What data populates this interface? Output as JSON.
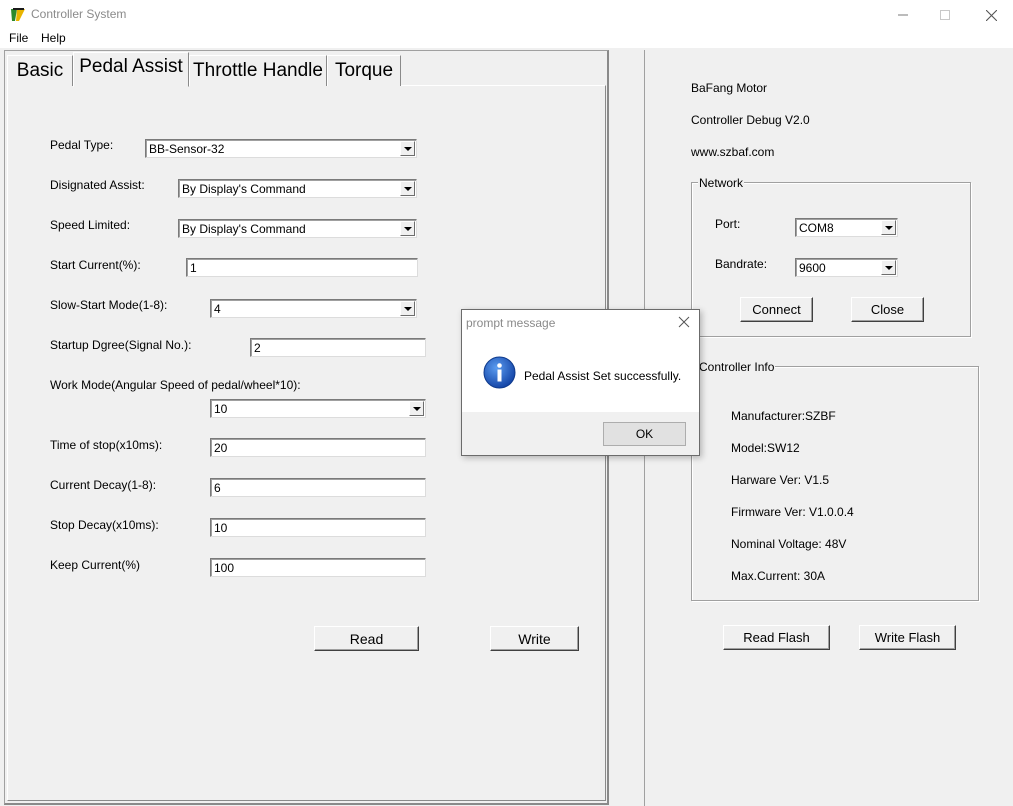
{
  "window": {
    "title": "Controller System",
    "icon": "app-logo-icon"
  },
  "menu": {
    "file": "File",
    "help": "Help"
  },
  "tabs": [
    {
      "label": "Basic",
      "active": false
    },
    {
      "label": "Pedal Assist",
      "active": true
    },
    {
      "label": "Throttle Handle",
      "active": false
    },
    {
      "label": "Torque",
      "active": false
    }
  ],
  "pedal_assist": {
    "pedal_type": {
      "label": "Pedal Type:",
      "value": "BB-Sensor-32"
    },
    "designated_assist": {
      "label": "Disignated Assist:",
      "value": "By Display's Command"
    },
    "speed_limited": {
      "label": "Speed Limited:",
      "value": "By Display's Command"
    },
    "start_current": {
      "label": "Start Current(%):",
      "value": "1"
    },
    "slow_start_mode": {
      "label": "Slow-Start Mode(1-8):",
      "value": "4"
    },
    "startup_degree": {
      "label": "Startup Dgree(Signal No.):",
      "value": "2"
    },
    "work_mode": {
      "label": "Work Mode(Angular Speed of pedal/wheel*10):",
      "value": "10"
    },
    "time_of_stop": {
      "label": "Time of stop(x10ms):",
      "value": "20"
    },
    "current_decay": {
      "label": "Current Decay(1-8):",
      "value": "6"
    },
    "stop_decay": {
      "label": "Stop Decay(x10ms):",
      "value": "10"
    },
    "keep_current": {
      "label": "Keep Current(%)",
      "value": "100"
    },
    "read_button": "Read",
    "write_button": "Write"
  },
  "info": {
    "company": "BaFang Motor",
    "product": "Controller Debug V2.0",
    "website": "www.szbaf.com"
  },
  "network": {
    "title": "Network",
    "port_label": "Port:",
    "port_value": "COM8",
    "baudrate_label": "Bandrate:",
    "baudrate_value": "9600",
    "connect_button": "Connect",
    "close_button": "Close"
  },
  "controller_info": {
    "title": "Controller Info",
    "manufacturer": "Manufacturer:SZBF",
    "model": "Model:SW12",
    "hardware": "Harware Ver: V1.5",
    "firmware": "Firmware Ver: V1.0.0.4",
    "voltage": "Nominal Voltage: 48V",
    "max_current": "Max.Current: 30A"
  },
  "flash": {
    "read": "Read Flash",
    "write": "Write Flash"
  },
  "dialog": {
    "title": "prompt message",
    "message": "Pedal Assist Set successfully.",
    "ok_button": "OK"
  },
  "colors": {
    "info_blue": "#1a5fc9",
    "dialog_footer": "#f0f0f0"
  }
}
